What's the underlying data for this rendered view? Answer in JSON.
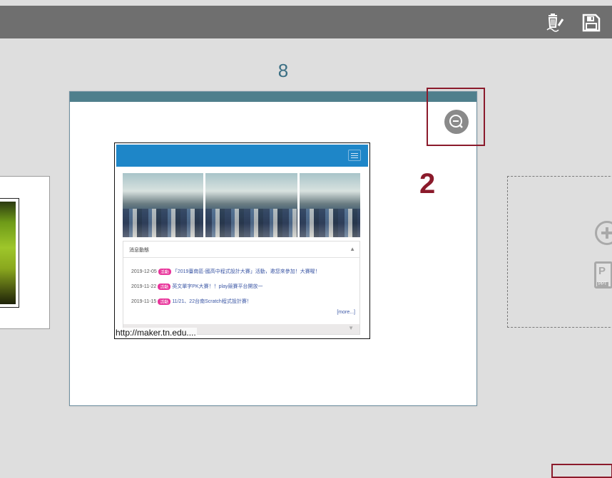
{
  "slide": {
    "page_number": "8",
    "step_marker": "2",
    "embed": {
      "caption": "http://maker.tn.edu....",
      "news": {
        "title": "消息動態",
        "items": [
          {
            "date": "2019-12-05",
            "tag": "活動",
            "text": "「2019臺南區-國高中程式設計大賽」活動，邀您來參加！大賽喔！"
          },
          {
            "date": "2019-11-22",
            "tag": "活動",
            "text": "英文單字PK大賽！！play競賽平台開放一"
          },
          {
            "date": "2019-11-15",
            "tag": "活動",
            "text": "11/21、22台南Scratch程式設計賽！"
          }
        ],
        "more": "[more...]"
      }
    }
  },
  "icons": {
    "trash": "trash-icon",
    "save": "save-icon",
    "zoom": "zoom-out-icon",
    "add": "add-circle-icon",
    "ppt": "ppt-file-icon"
  },
  "colors": {
    "accent": "#8b1a2b",
    "slide_bar": "#4f7f8c",
    "site_header": "#1e86c8",
    "tag": "#e8339a"
  }
}
